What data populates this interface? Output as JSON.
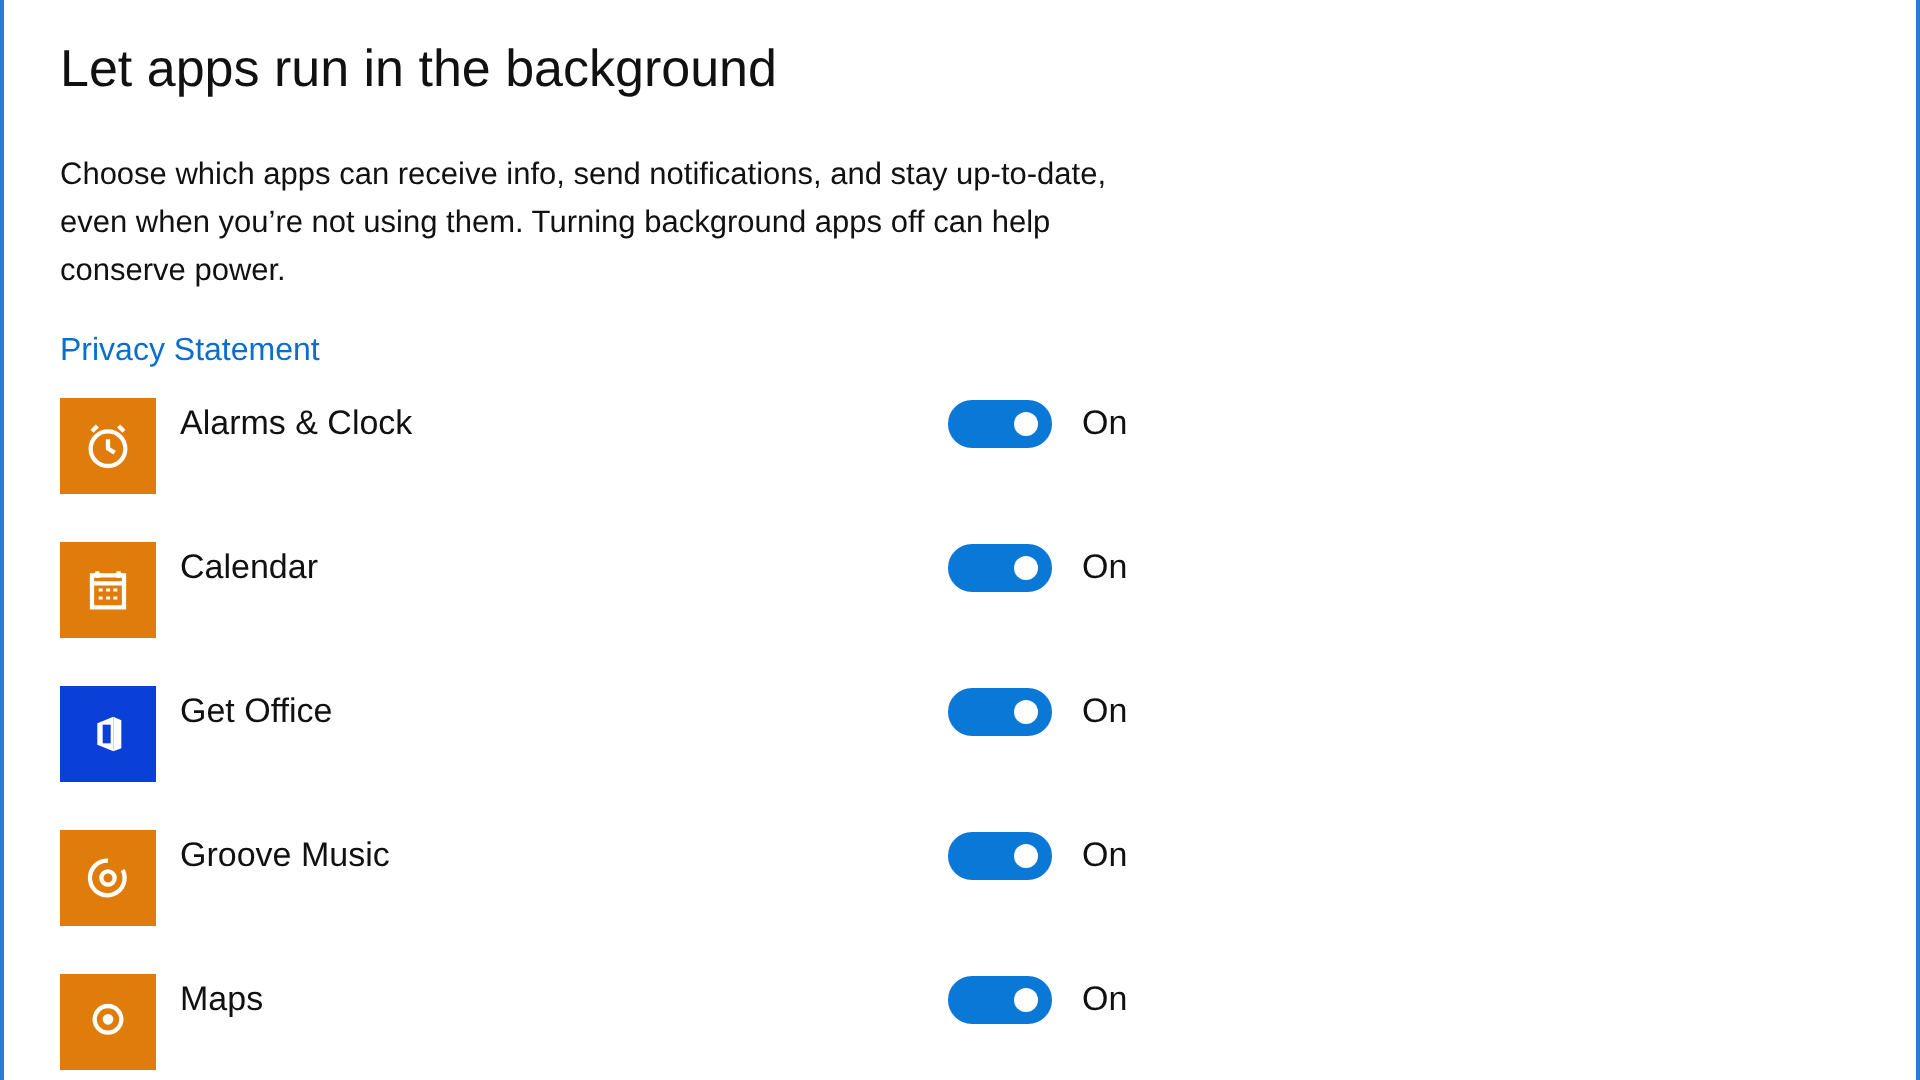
{
  "heading": "Let apps run in the background",
  "description": "Choose which apps can receive info, send notifications, and stay up-to-date, even when you’re not using them. Turning background apps off can help conserve power.",
  "privacy_link": "Privacy Statement",
  "apps": [
    {
      "name": "Alarms & Clock",
      "color": "#e07c0b",
      "on": true,
      "state_label": "On"
    },
    {
      "name": "Calendar",
      "color": "#e07c0b",
      "on": true,
      "state_label": "On"
    },
    {
      "name": "Get Office",
      "color": "#0a3fd8",
      "on": true,
      "state_label": "On"
    },
    {
      "name": "Groove Music",
      "color": "#e07c0b",
      "on": true,
      "state_label": "On"
    },
    {
      "name": "Maps",
      "color": "#e07c0b",
      "on": true,
      "state_label": "On"
    }
  ]
}
